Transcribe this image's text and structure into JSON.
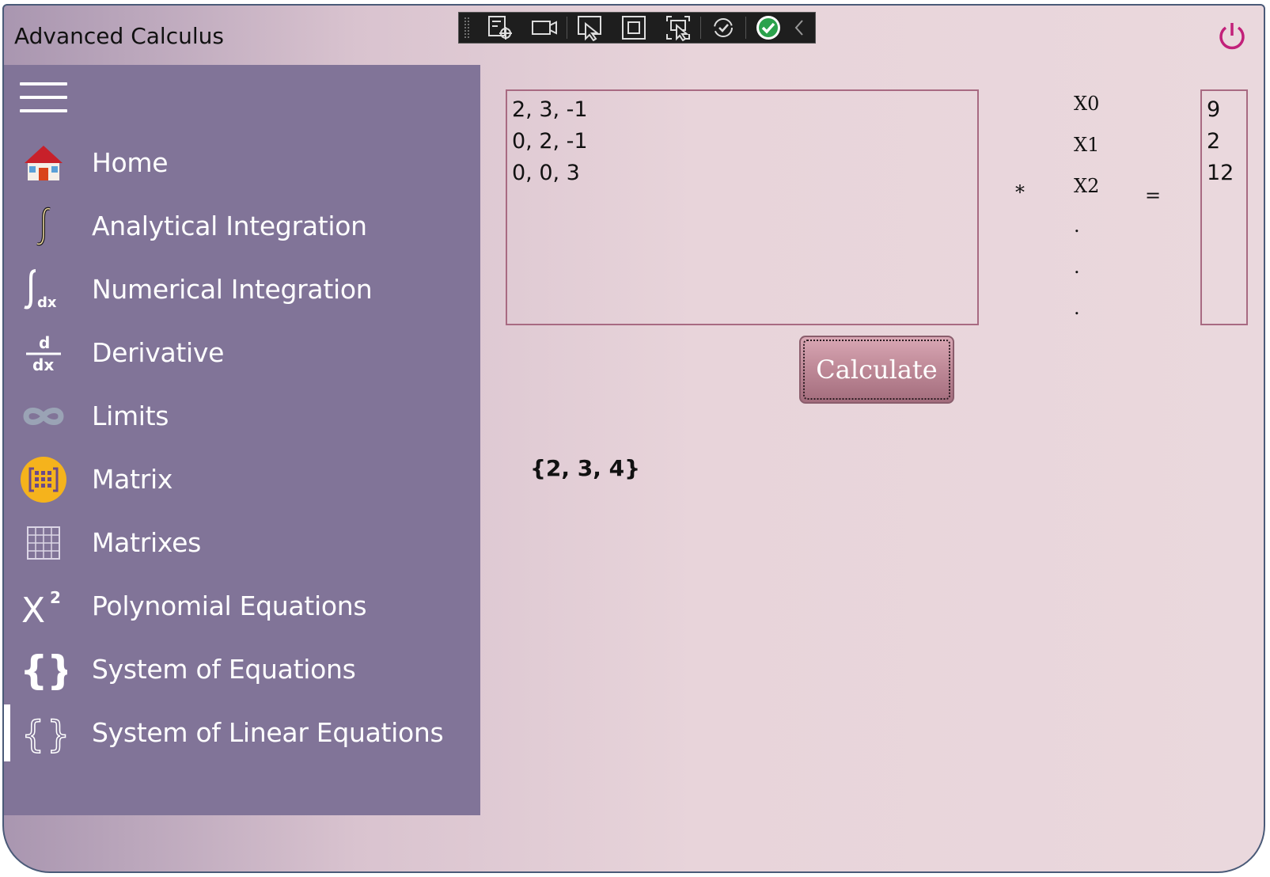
{
  "app": {
    "title": "Advanced Calculus"
  },
  "debug_toolbar": {
    "icons": [
      "live-visual-tree-icon",
      "camera-icon",
      "select-element-icon",
      "display-layout-adorners-icon",
      "track-focus-icon",
      "hot-reload-icon",
      "check-icon",
      "collapse-chevron-icon"
    ]
  },
  "nav": {
    "items": [
      {
        "label": "Home",
        "icon": "home-icon"
      },
      {
        "label": "Analytical Integration",
        "icon": "integral-icon"
      },
      {
        "label": "Numerical Integration",
        "icon": "integral-dx-icon"
      },
      {
        "label": "Derivative",
        "icon": "derivative-icon"
      },
      {
        "label": "Limits",
        "icon": "infinity-icon"
      },
      {
        "label": "Matrix",
        "icon": "matrix-icon"
      },
      {
        "label": "Matrixes",
        "icon": "grid-icon"
      },
      {
        "label": "Polynomial Equations",
        "icon": "x-squared-icon"
      },
      {
        "label": "System of Equations",
        "icon": "braces-icon"
      },
      {
        "label": "System of Linear Equations",
        "icon": "braces-outline-icon"
      }
    ],
    "selected": "System of Linear Equations"
  },
  "equation": {
    "matrix_value": "2, 3, -1\n0, 2, -1\n0, 0, 3",
    "variables": [
      "X0",
      "X1",
      "X2",
      ".",
      ".",
      "."
    ],
    "multiply_symbol": "*",
    "equals_symbol": "=",
    "result_value": "9\n2\n12"
  },
  "actions": {
    "calculate_label": "Calculate"
  },
  "output": {
    "solution": "{2, 3, 4}"
  },
  "colors": {
    "sidebar": "#817498",
    "accent_power": "#c2207a",
    "button": "#b8808f"
  }
}
